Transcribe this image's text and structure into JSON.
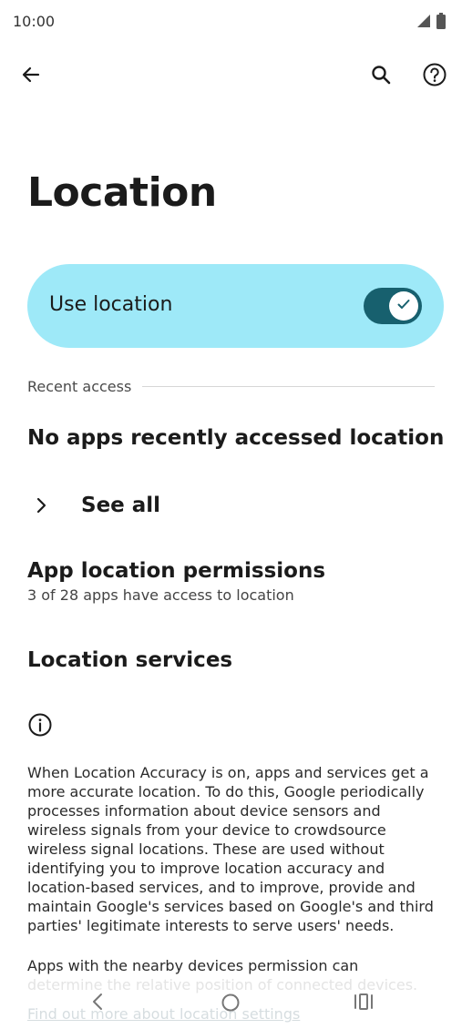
{
  "status_bar": {
    "time": "10:00",
    "icons": [
      "signal-icon",
      "battery-icon"
    ]
  },
  "toolbar": {
    "back_icon": "back-arrow-icon",
    "search_icon": "search-icon",
    "help_icon": "help-icon"
  },
  "page": {
    "title": "Location"
  },
  "use_location": {
    "label": "Use location",
    "enabled": true,
    "accent_color": "#9ee9f8",
    "toggle_color": "#17606e"
  },
  "recent_access": {
    "header": "Recent access",
    "empty_text": "No apps recently accessed location",
    "see_all_label": "See all"
  },
  "app_permissions": {
    "title": "App location permissions",
    "subtitle": "3 of 28 apps have access to location"
  },
  "location_services": {
    "title": "Location services"
  },
  "info": {
    "paragraph_1_lines": [
      "When Location Accuracy is on, apps and services get a",
      "more accurate location. To do this, Google periodically",
      "processes information about device sensors and",
      "wireless signals from your device to crowdsource",
      "wireless signal locations. These are used without",
      "identifying you to improve location accuracy and",
      "location-based services, and to improve, provide and",
      "maintain Google's services based on Google's and third",
      "parties' legitimate interests to serve users' needs."
    ],
    "paragraph_2_line_1": "Apps with the nearby devices permission can",
    "paragraph_2_line_2": "determine the relative position of connected devices.",
    "learn_more": "Find out more about location settings"
  },
  "nav_bar": {
    "back": "nav-back-icon",
    "home": "nav-home-icon",
    "recents": "nav-recents-icon"
  }
}
